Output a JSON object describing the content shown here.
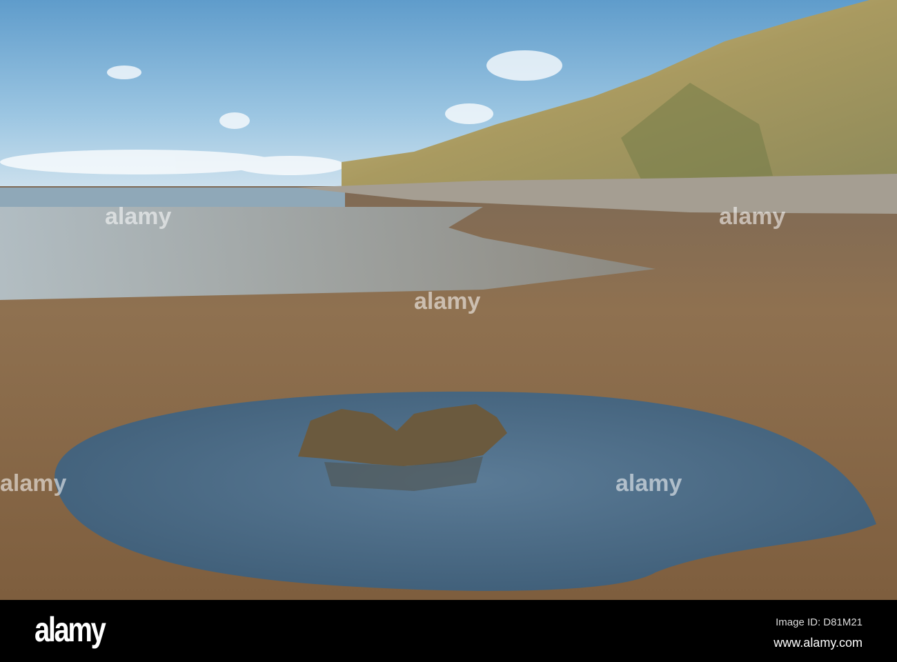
{
  "footer": {
    "logo": "alamy",
    "image_id": "Image ID: D81M21",
    "website": "www.alamy.com"
  },
  "watermark": "alamy",
  "colors": {
    "sky": "#7fb4d8",
    "sand": "#8a6a48",
    "pool": "#4d6d88",
    "cliff": "#b8a46a"
  }
}
